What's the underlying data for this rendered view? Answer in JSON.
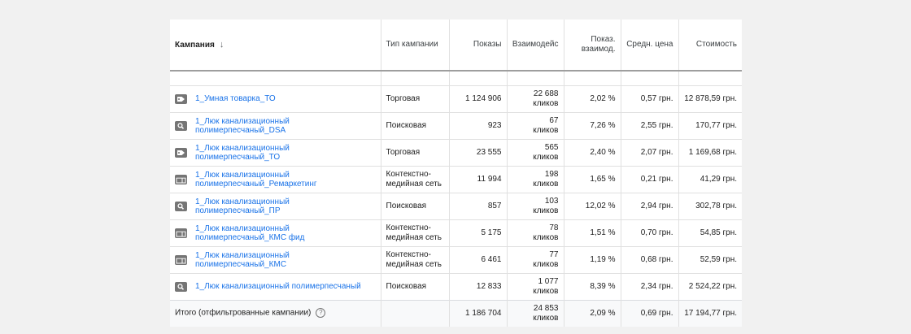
{
  "headers": {
    "campaign": "Кампания",
    "type": "Тип кампании",
    "impressions": "Показы",
    "interactions": "Взаимодейс",
    "interaction_rate": "Показ. взаимод.",
    "avg_cost": "Средн. цена",
    "cost": "Стоимость"
  },
  "rows": [
    {
      "icon": "tag-icon",
      "name": "1_Умная товарка_ТО",
      "type": "Торговая",
      "impressions": "1 124 906",
      "interactions_value": "22 688",
      "interactions_unit": "кликов",
      "rate": "2,02 %",
      "avg": "0,57 грн.",
      "cost": "12 878,59 грн."
    },
    {
      "icon": "search-icon",
      "name": "1_Люк канализационный полимерпесчаный_DSA",
      "type": "Поисковая",
      "impressions": "923",
      "interactions_value": "67",
      "interactions_unit": "кликов",
      "rate": "7,26 %",
      "avg": "2,55 грн.",
      "cost": "170,77 грн."
    },
    {
      "icon": "tag-icon",
      "name": "1_Люк канализационный полимерпесчаный_ТО",
      "type": "Торговая",
      "impressions": "23 555",
      "interactions_value": "565",
      "interactions_unit": "кликов",
      "rate": "2,40 %",
      "avg": "2,07 грн.",
      "cost": "1 169,68 грн."
    },
    {
      "icon": "display-icon",
      "name": "1_Люк канализационный полимерпесчаный_Ремаркетинг",
      "type": "Контекстно-медийная сеть",
      "impressions": "11 994",
      "interactions_value": "198",
      "interactions_unit": "кликов",
      "rate": "1,65 %",
      "avg": "0,21 грн.",
      "cost": "41,29 грн."
    },
    {
      "icon": "search-icon",
      "name": "1_Люк канализационный полимерпесчаный_ПР",
      "type": "Поисковая",
      "impressions": "857",
      "interactions_value": "103",
      "interactions_unit": "кликов",
      "rate": "12,02 %",
      "avg": "2,94 грн.",
      "cost": "302,78 грн."
    },
    {
      "icon": "display-icon",
      "name": "1_Люк канализационный полимерпесчаный_КМС фид",
      "type": "Контекстно-медийная сеть",
      "impressions": "5 175",
      "interactions_value": "78",
      "interactions_unit": "кликов",
      "rate": "1,51 %",
      "avg": "0,70 грн.",
      "cost": "54,85 грн."
    },
    {
      "icon": "display-icon",
      "name": "1_Люк канализационный полимерпесчаный_КМС",
      "type": "Контекстно-медийная сеть",
      "impressions": "6 461",
      "interactions_value": "77",
      "interactions_unit": "кликов",
      "rate": "1,19 %",
      "avg": "0,68 грн.",
      "cost": "52,59 грн."
    },
    {
      "icon": "search-icon",
      "name": "1_Люк канализационный полимерпесчаный",
      "type": "Поисковая",
      "impressions": "12 833",
      "interactions_value": "1 077",
      "interactions_unit": "кликов",
      "rate": "8,39 %",
      "avg": "2,34 грн.",
      "cost": "2 524,22 грн."
    }
  ],
  "total": {
    "label": "Итого (отфильтрованные кампании)",
    "help_icon": "help-icon",
    "impressions": "1 186 704",
    "interactions_value": "24 853",
    "interactions_unit": "кликов",
    "rate": "2,09 %",
    "avg": "0,69 грн.",
    "cost": "17 194,77 грн."
  }
}
